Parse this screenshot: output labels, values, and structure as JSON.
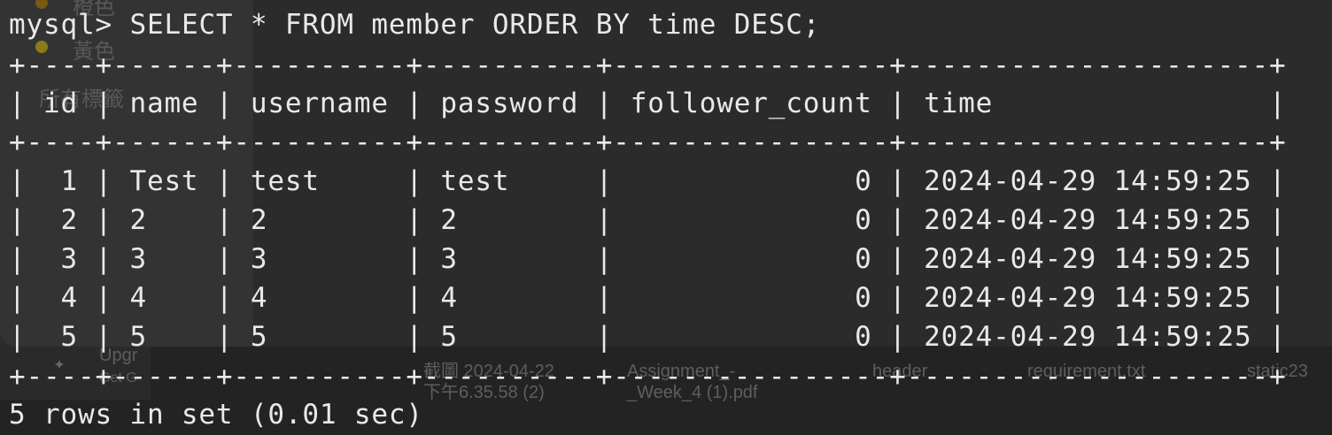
{
  "background": {
    "sidebar_items": [
      "橙色",
      "黃色",
      "所有標籤"
    ],
    "dock_items": [
      {
        "line1": "Upgr",
        "line2": "Get G"
      },
      {
        "line1": "截圖 2024-04-22",
        "line2": "下午6.35.58 (2)"
      },
      {
        "line1": "Assignment_-",
        "line2": "_Week_4 (1).pdf"
      },
      {
        "line1": "header",
        "line2": ""
      },
      {
        "line1": "requirement.txt",
        "line2": ""
      },
      {
        "line1": "static23",
        "line2": ""
      }
    ],
    "sparkle_icon": "sparkle-icon"
  },
  "terminal": {
    "prompt": "mysql>",
    "command": "SELECT * FROM member ORDER BY time DESC;",
    "separator": "+----+------+----------+----------+----------------+---------------------+",
    "header_row": "| id | name | username | password | follower_count | time                |",
    "rows": [
      "|  1 | Test | test     | test     |              0 | 2024-04-29 14:59:25 |",
      "|  2 | 2    | 2        | 2        |              0 | 2024-04-29 14:59:25 |",
      "|  3 | 3    | 3        | 3        |              0 | 2024-04-29 14:59:25 |",
      "|  4 | 4    | 4        | 4        |              0 | 2024-04-29 14:59:25 |",
      "|  5 | 5    | 5        | 5        |              0 | 2024-04-29 14:59:25 |"
    ],
    "summary": "5 rows in set (0.01 sec)"
  }
}
